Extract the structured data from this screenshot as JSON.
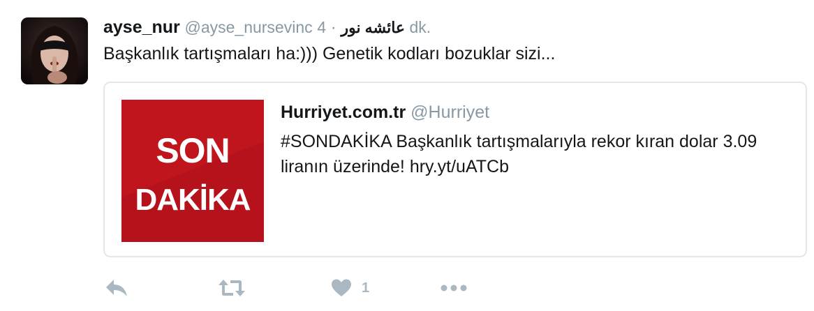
{
  "tweet": {
    "display_name": "ayse_nur",
    "handle": "@ayse_nursevinc",
    "arabic_name": "عائشه نور",
    "separator": "·",
    "timestamp": "4 dk.",
    "text": "Başkanlık tartışmaları ha:))) Genetik kodları bozuklar sizi...",
    "avatar_icon": "user-avatar-photo"
  },
  "quoted": {
    "display_name": "Hurriyet.com.tr",
    "handle": "@Hurriyet",
    "text": "#SONDAKİKA Başkanlık tartışmalarıyla rekor kıran dolar 3.09 liranın üzerinde! hry.yt/uATCb",
    "media": {
      "line1": "SON",
      "line2": "DAKİKA",
      "background": "#b5121b"
    }
  },
  "actions": {
    "reply_icon": "reply-icon",
    "retweet_icon": "retweet-icon",
    "like_icon": "heart-icon",
    "like_count": "1",
    "more_icon": "more-icon"
  },
  "colors": {
    "text_primary": "#14171a",
    "text_secondary": "#8899a6",
    "action_gray": "#aab8c2",
    "border": "#e1e8ed"
  }
}
